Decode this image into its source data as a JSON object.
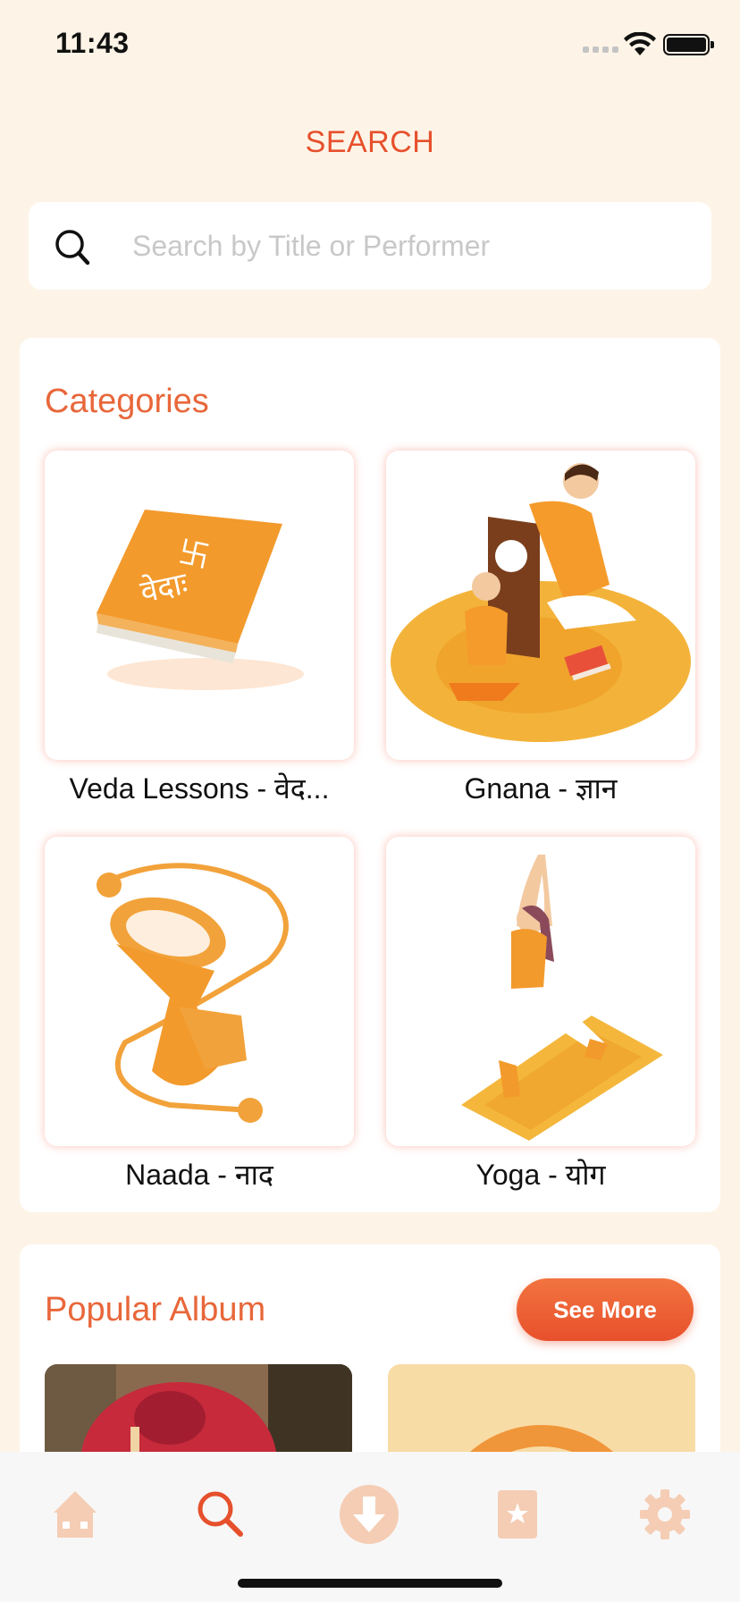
{
  "status_bar": {
    "time": "11:43"
  },
  "header": {
    "title": "SEARCH"
  },
  "search": {
    "placeholder": "Search by Title or Performer",
    "value": ""
  },
  "categories": {
    "title": "Categories",
    "items": [
      {
        "label": "Veda Lessons - वेद..."
      },
      {
        "label": "Gnana - ज्ञान"
      },
      {
        "label": "Naada - नाद"
      },
      {
        "label": "Yoga - योग"
      }
    ]
  },
  "popular_album": {
    "title": "Popular Album",
    "see_more_label": "See More"
  },
  "book_text": {
    "symbol": "卐",
    "word": "वेदाः"
  },
  "tab_bar": {
    "items": [
      {
        "icon": "home-icon",
        "active": false
      },
      {
        "icon": "search-icon",
        "active": true
      },
      {
        "icon": "download-icon",
        "active": false
      },
      {
        "icon": "favorites-book-icon",
        "active": false
      },
      {
        "icon": "gear-icon",
        "active": false
      }
    ]
  },
  "colors": {
    "accent": "#e6502c",
    "section_title": "#e8673a",
    "background": "#fdf4e7",
    "tab_inactive": "#f5cdb4"
  }
}
